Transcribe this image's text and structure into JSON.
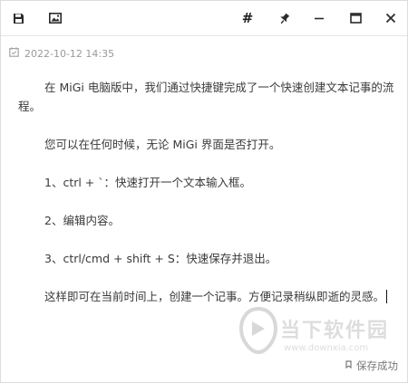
{
  "toolbar": {
    "save_icon": "floppy-disk-icon",
    "image_icon": "image-icon",
    "hash_label": "#",
    "pin_icon": "pin-icon",
    "minimize_icon": "minimize-icon",
    "maximize_icon": "maximize-icon",
    "close_icon": "close-icon"
  },
  "note": {
    "timestamp": "2022-10-12 14:35",
    "paragraphs": [
      "在 MiGi 电脑版中，我们通过快捷键完成了一个快速创建文本记事的流程。",
      "您可以在任何时候，无论 MiGi 界面是否打开。",
      "1、ctrl + `：快速打开一个文本输入框。",
      "2、编辑内容。",
      "3、ctrl/cmd + shift + S：快速保存并退出。",
      "这样即可在当前时间上，创建一个记事。方便记录稍纵即逝的灵感。"
    ]
  },
  "watermark": {
    "brand": "当下软件园",
    "url": "www.downxia.com"
  },
  "status": {
    "text": "保存成功"
  },
  "colors": {
    "text": "#3a3a3a",
    "muted": "#9a9a9a",
    "border": "#dcdcdc"
  }
}
